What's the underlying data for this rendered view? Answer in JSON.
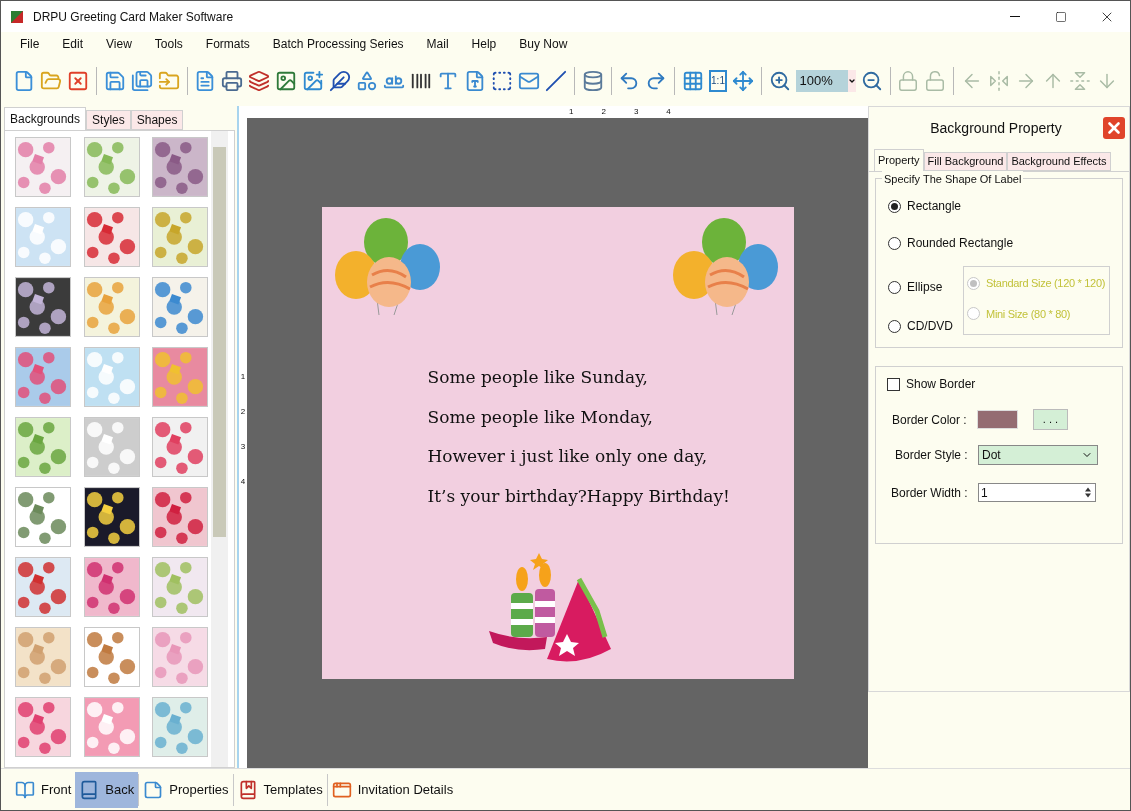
{
  "window": {
    "title": "DRPU Greeting Card Maker Software"
  },
  "menu": [
    "File",
    "Edit",
    "View",
    "Tools",
    "Formats",
    "Batch Processing Series",
    "Mail",
    "Help",
    "Buy Now"
  ],
  "toolbar": [
    {
      "kind": "icon",
      "disabled": false
    },
    {
      "kind": "icon",
      "disabled": false
    },
    {
      "kind": "icon",
      "disabled": false
    },
    {
      "kind": "separator"
    },
    {
      "kind": "icon",
      "disabled": false
    },
    {
      "kind": "icon",
      "disabled": false
    },
    {
      "kind": "icon",
      "disabled": false
    },
    {
      "kind": "separator"
    },
    {
      "kind": "icon",
      "disabled": false
    },
    {
      "kind": "icon",
      "disabled": false
    },
    {
      "kind": "icon",
      "disabled": false
    },
    {
      "kind": "icon",
      "disabled": false
    },
    {
      "kind": "icon",
      "disabled": false
    },
    {
      "kind": "icon",
      "disabled": false
    },
    {
      "kind": "icon",
      "disabled": false
    },
    {
      "kind": "icon",
      "disabled": false
    },
    {
      "kind": "icon",
      "disabled": false
    },
    {
      "kind": "icon",
      "disabled": false
    },
    {
      "kind": "icon",
      "disabled": false
    },
    {
      "kind": "icon",
      "disabled": false
    },
    {
      "kind": "icon",
      "disabled": false
    },
    {
      "kind": "icon",
      "disabled": false
    },
    {
      "kind": "separator"
    },
    {
      "kind": "icon",
      "disabled": false
    },
    {
      "kind": "separator"
    },
    {
      "kind": "icon",
      "disabled": false
    },
    {
      "kind": "icon",
      "disabled": false
    },
    {
      "kind": "separator"
    },
    {
      "kind": "icon",
      "disabled": false
    },
    {
      "kind": "label",
      "label": "1:1"
    },
    {
      "kind": "icon",
      "disabled": false
    },
    {
      "kind": "separator"
    },
    {
      "kind": "icon",
      "disabled": false
    },
    {
      "kind": "zoom",
      "value": "100%"
    },
    {
      "kind": "icon",
      "disabled": false
    },
    {
      "kind": "separator"
    },
    {
      "kind": "icon",
      "disabled": true
    },
    {
      "kind": "icon",
      "disabled": true
    },
    {
      "kind": "separator"
    },
    {
      "kind": "icon",
      "disabled": true
    },
    {
      "kind": "icon",
      "disabled": true
    },
    {
      "kind": "icon",
      "disabled": true
    },
    {
      "kind": "icon",
      "disabled": true
    },
    {
      "kind": "icon",
      "disabled": true
    },
    {
      "kind": "icon",
      "disabled": true
    }
  ],
  "left_panel": {
    "tabs": [
      {
        "label": "Backgrounds",
        "selected": true
      },
      {
        "label": "Styles",
        "selected": false
      },
      {
        "label": "Shapes",
        "selected": false
      }
    ]
  },
  "ruler": {
    "horizontal": [
      "1",
      "2",
      "3",
      "4"
    ],
    "vertical": [
      "1",
      "2",
      "3",
      "4"
    ]
  },
  "card": {
    "lines": [
      "Some people like Sunday,",
      "Some people like Monday,",
      "However i just like only one day,",
      "It’s your birthday?Happy Birthday!"
    ]
  },
  "right_panel": {
    "title": "Background Property",
    "tabs": [
      {
        "label": "Property",
        "selected": true
      },
      {
        "label": "Fill Background",
        "selected": false
      },
      {
        "label": "Background Effects",
        "selected": false
      }
    ],
    "shape_group": {
      "legend": "Specify The Shape Of Label",
      "options": [
        {
          "label": "Rectangle",
          "selected": true
        },
        {
          "label": "Rounded Rectangle",
          "selected": false
        },
        {
          "label": "Ellipse",
          "selected": false
        },
        {
          "label": "CD/DVD",
          "selected": false
        }
      ],
      "sizes": [
        {
          "label": "Standard Size (120 * 120)",
          "selected": true,
          "disabled": true
        },
        {
          "label": "Mini Size (80 * 80)",
          "selected": false,
          "disabled": true
        }
      ]
    },
    "border": {
      "show_border": {
        "label": "Show Border",
        "checked": false
      },
      "color": {
        "label": "Border Color :",
        "color": "#946c72",
        "button": ". . ."
      },
      "style": {
        "label": "Border Style :",
        "value": "Dot"
      },
      "width": {
        "label": "Border Width :",
        "value": "1"
      }
    }
  },
  "bottom_bar": [
    {
      "label": "Front",
      "selected": false
    },
    {
      "label": "Back",
      "selected": true
    },
    {
      "label": "Properties",
      "selected": false
    },
    {
      "label": "Templates",
      "selected": false
    },
    {
      "label": "Invitation Details",
      "selected": false
    }
  ]
}
